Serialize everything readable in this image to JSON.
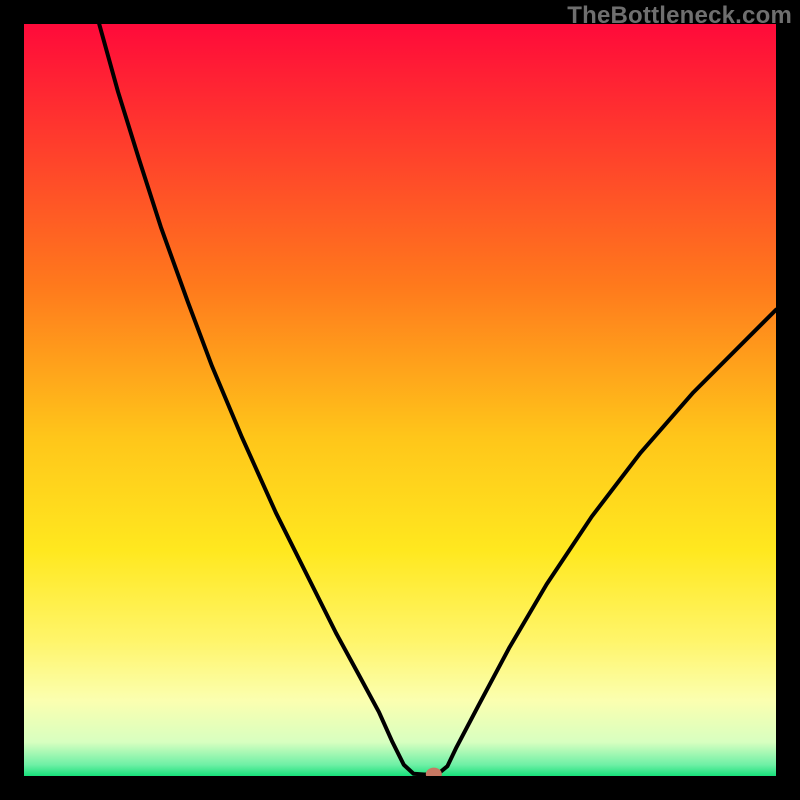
{
  "watermark": "TheBottleneck.com",
  "colors": {
    "curve": "#000000",
    "marker_fill": "#c77863",
    "marker_stroke": "#9c5a49",
    "frame": "#000000"
  },
  "chart_data": {
    "type": "line",
    "title": "",
    "xlabel": "",
    "ylabel": "",
    "xlim": [
      0,
      100
    ],
    "ylim": [
      0,
      100
    ],
    "gradient_stops": [
      {
        "offset": 0.0,
        "color": "#ff0a3a"
      },
      {
        "offset": 0.15,
        "color": "#ff3a2d"
      },
      {
        "offset": 0.35,
        "color": "#ff7a1c"
      },
      {
        "offset": 0.55,
        "color": "#ffc61a"
      },
      {
        "offset": 0.7,
        "color": "#ffe81f"
      },
      {
        "offset": 0.82,
        "color": "#fff56a"
      },
      {
        "offset": 0.9,
        "color": "#fbffb0"
      },
      {
        "offset": 0.955,
        "color": "#d8ffc0"
      },
      {
        "offset": 0.985,
        "color": "#6ff0a6"
      },
      {
        "offset": 1.0,
        "color": "#17e07a"
      }
    ],
    "series": [
      {
        "name": "bottleneck-curve",
        "x": [
          10.0,
          12.5,
          15.3,
          18.2,
          21.8,
          25.0,
          29.0,
          33.5,
          37.5,
          41.5,
          44.5,
          47.2,
          49.0,
          50.5,
          51.8,
          53.2,
          54.5,
          55.2,
          56.3,
          57.5,
          60.5,
          64.5,
          69.5,
          75.5,
          82.0,
          89.0,
          96.0,
          100.0
        ],
        "y": [
          100.0,
          91.0,
          82.0,
          73.0,
          63.0,
          54.5,
          45.0,
          35.0,
          27.0,
          19.0,
          13.5,
          8.5,
          4.5,
          1.5,
          0.3,
          0.2,
          0.2,
          0.4,
          1.3,
          3.8,
          9.5,
          17.0,
          25.5,
          34.5,
          43.0,
          51.0,
          58.0,
          62.0
        ]
      }
    ],
    "marker": {
      "x": 54.5,
      "y": 0.25
    }
  }
}
